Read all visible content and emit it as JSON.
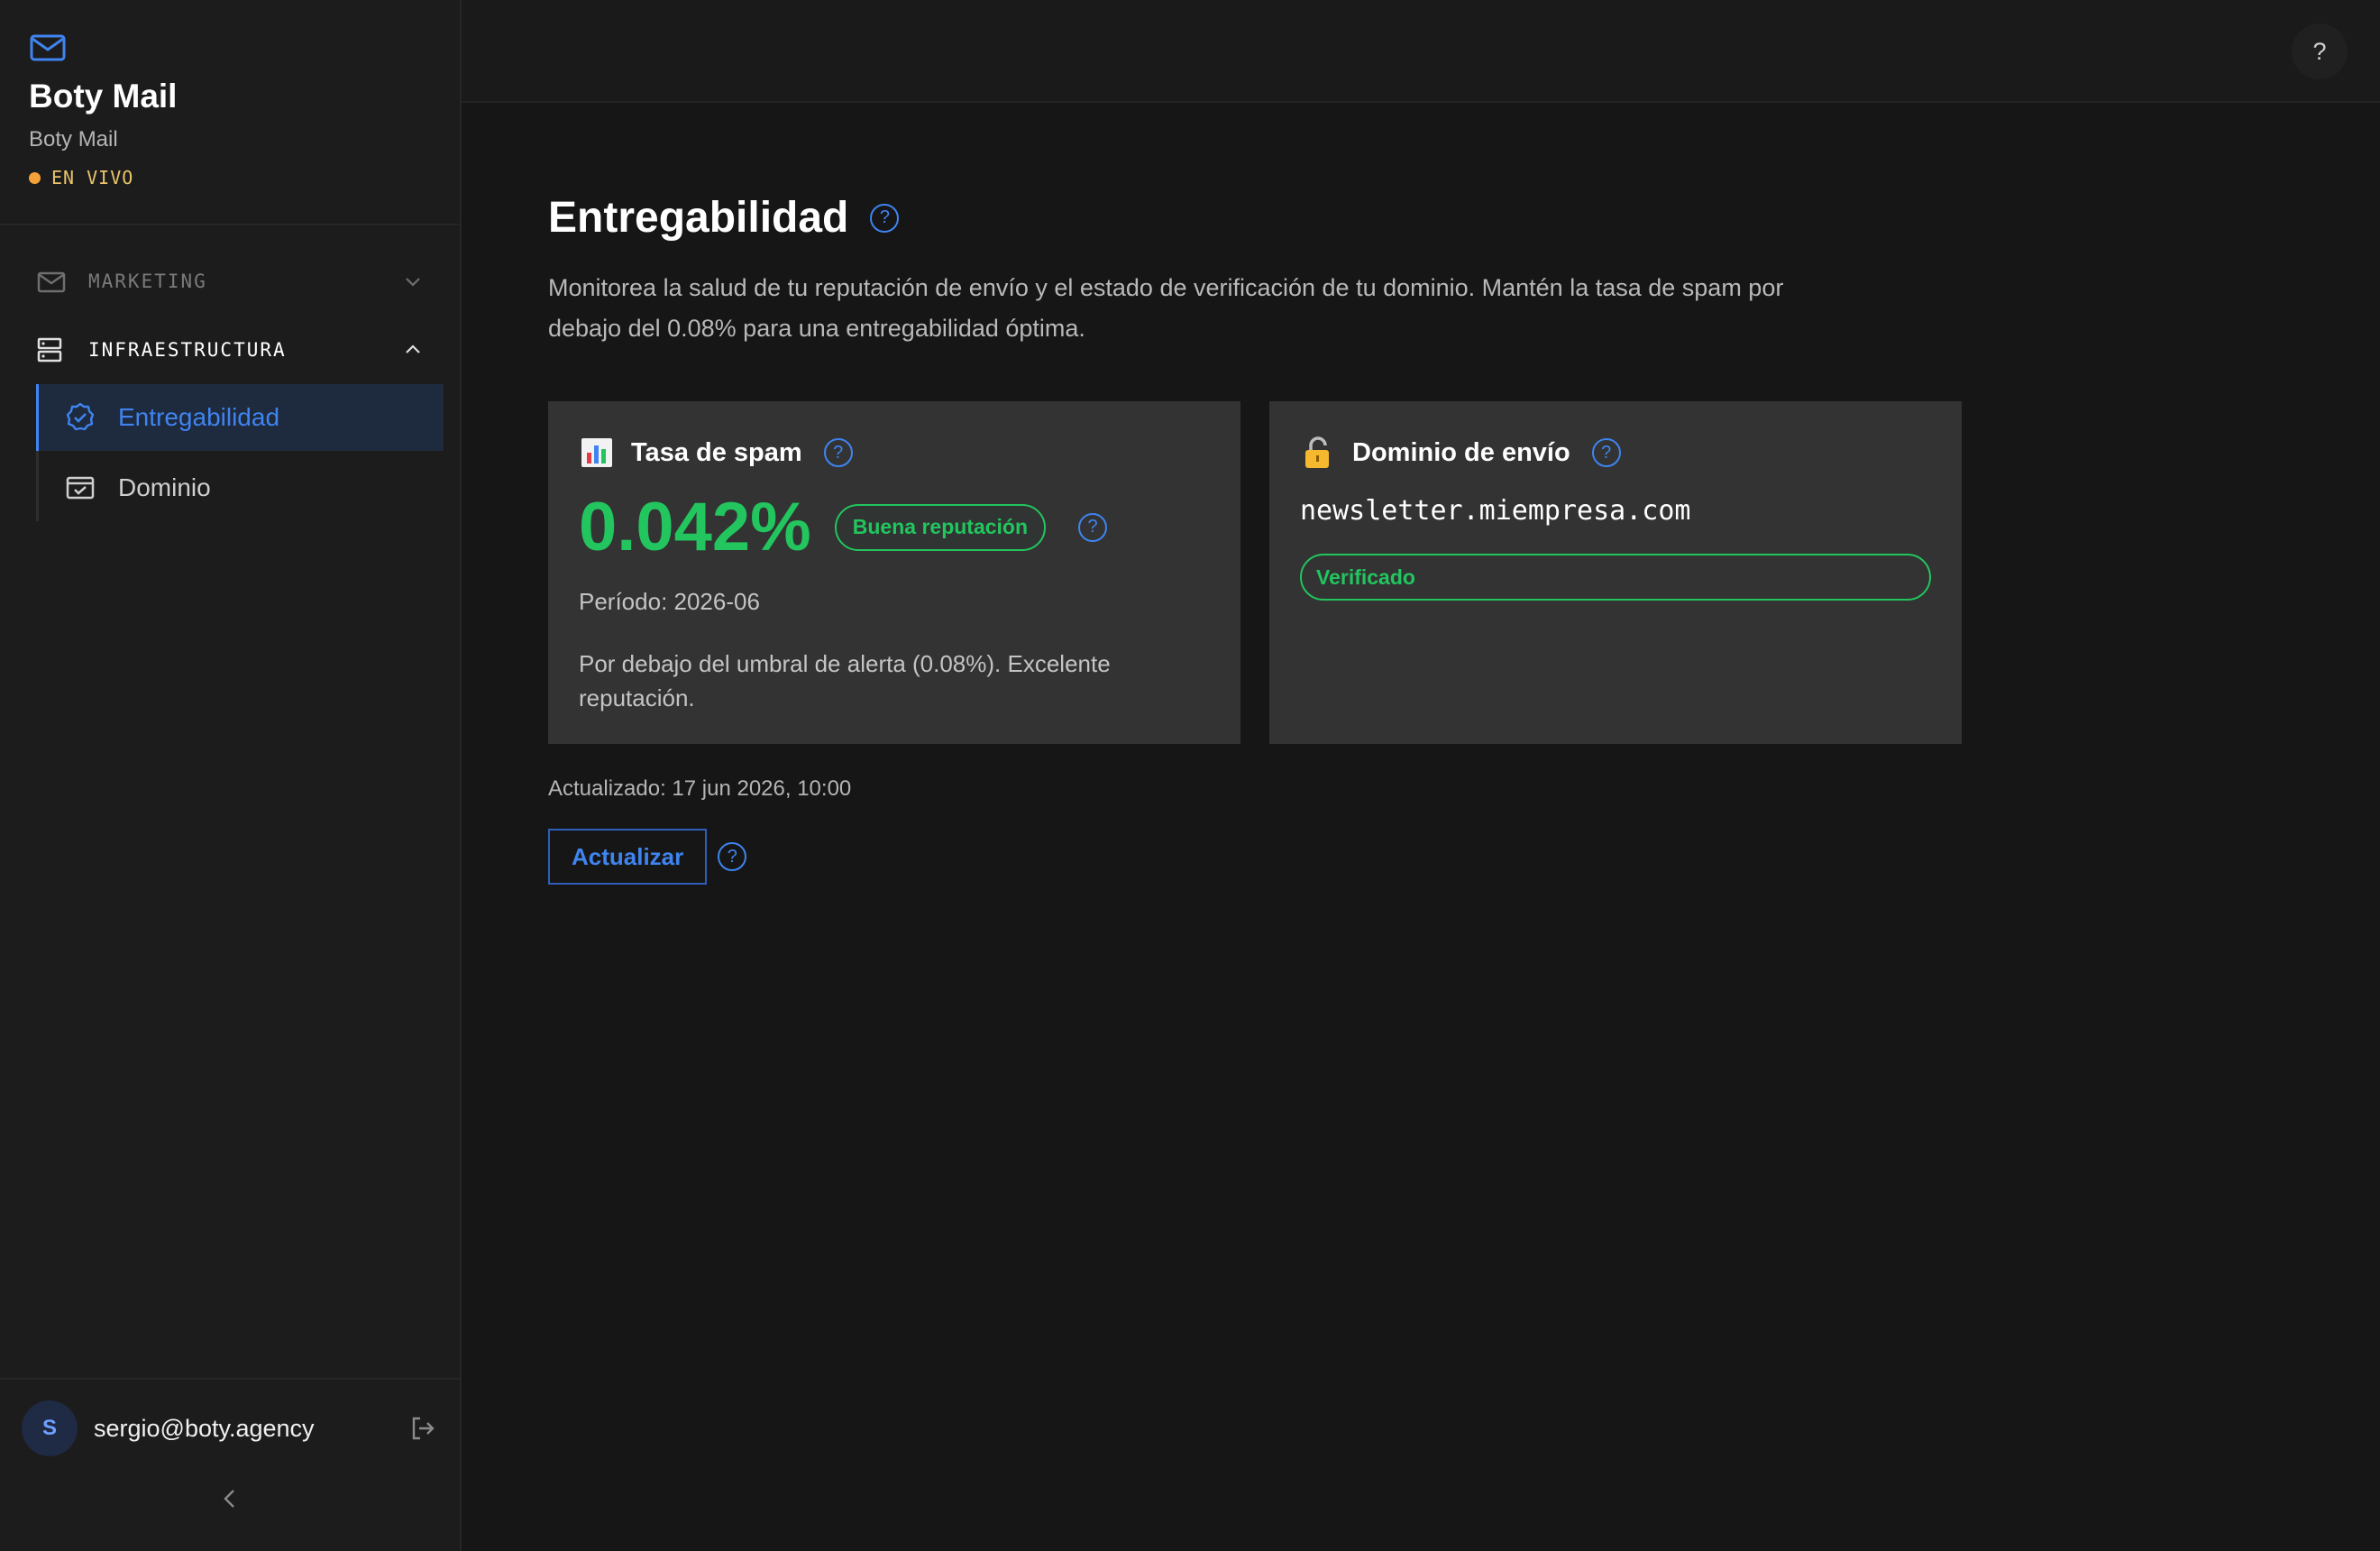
{
  "brand": {
    "name": "Boty Mail",
    "subtitle": "Boty Mail",
    "status": "EN VIVO",
    "icon": "mail-icon"
  },
  "nav": {
    "sections": [
      {
        "label": "MARKETING",
        "icon": "mail-open-icon",
        "expanded": false
      },
      {
        "label": "INFRAESTRUCTURA",
        "icon": "server-icon",
        "expanded": true
      }
    ],
    "items": [
      {
        "label": "Entregabilidad",
        "icon": "badge-check-icon",
        "active": true
      },
      {
        "label": "Dominio",
        "icon": "browser-check-icon",
        "active": false
      }
    ]
  },
  "user": {
    "initial": "S",
    "email": "sergio@boty.agency"
  },
  "topbar": {
    "help": "?"
  },
  "page": {
    "title": "Entregabilidad",
    "help": "?",
    "description": "Monitorea la salud de tu reputación de envío y el estado de verificación de tu dominio. Mantén la tasa de spam por debajo del 0.08% para una entregabilidad óptima."
  },
  "spam_card": {
    "icon": "bar-chart-icon",
    "title": "Tasa de spam",
    "help": "?",
    "rate": "0.042%",
    "badge": "Buena reputación",
    "badge_help": "?",
    "period": "Período: 2026-06",
    "note": "Por debajo del umbral de alerta (0.08%). Excelente reputación."
  },
  "domain_card": {
    "icon": "lock-icon",
    "title": "Dominio de envío",
    "help": "?",
    "domain": "newsletter.miempresa.com",
    "status": "Verificado"
  },
  "footer": {
    "updated": "Actualizado: 17 jun 2026, 10:00",
    "refresh_label": "Actualizar",
    "refresh_help": "?"
  },
  "colors": {
    "accent": "#3f84f0",
    "success": "#22c55e",
    "live": "#f4a13a"
  }
}
